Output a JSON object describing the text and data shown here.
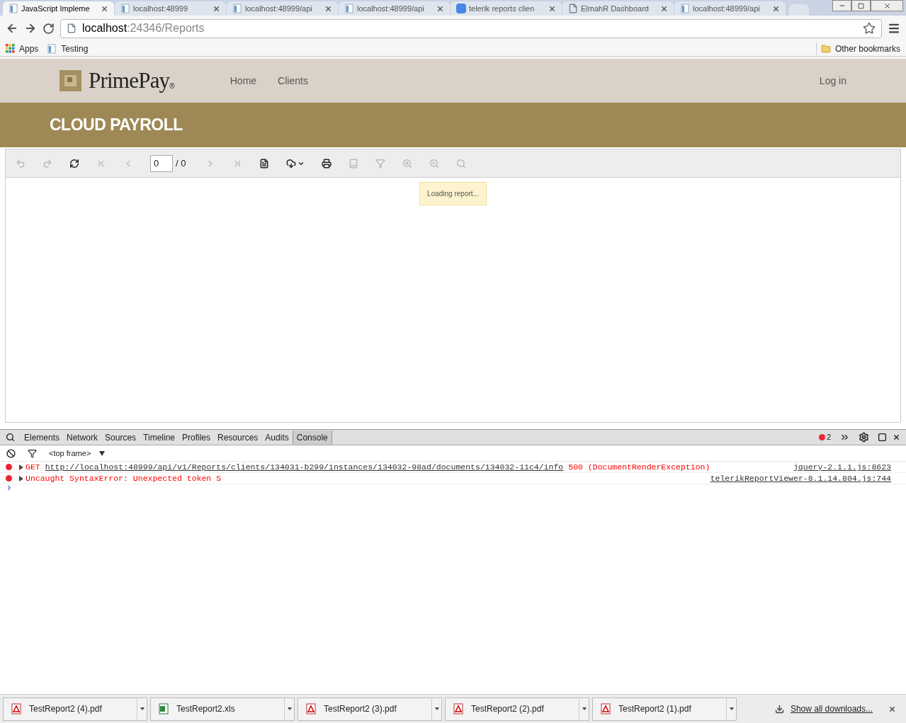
{
  "tabs": [
    {
      "label": "JavaScript Impleme",
      "kind": "doc",
      "selected": true
    },
    {
      "label": "localhost:48999",
      "kind": "doc",
      "selected": false
    },
    {
      "label": "localhost:48999/api",
      "kind": "doc",
      "selected": false
    },
    {
      "label": "localhost:48999/api",
      "kind": "doc",
      "selected": false
    },
    {
      "label": "telerik reports clien",
      "kind": "google",
      "selected": false
    },
    {
      "label": "ElmahR Dashboard",
      "kind": "page",
      "selected": false
    },
    {
      "label": "localhost:48999/api",
      "kind": "doc",
      "selected": false
    }
  ],
  "address": {
    "host": "localhost",
    "rest": ":24346/Reports"
  },
  "bookmarks": [
    {
      "label": "Apps",
      "kind": "apps"
    },
    {
      "label": "Testing",
      "kind": "doc"
    }
  ],
  "other_bookmarks": "Other bookmarks",
  "site": {
    "logo": "PrimePay",
    "logo_mark": "®",
    "nav": [
      "Home",
      "Clients"
    ],
    "login": "Log in",
    "banner": "CLOUD PAYROLL"
  },
  "viewer": {
    "buttons": [
      {
        "enabled": false
      },
      {
        "enabled": false
      },
      {
        "enabled": true
      },
      {
        "enabled": false
      },
      {
        "enabled": false
      },
      {
        "enabled": false
      },
      {
        "enabled": false
      },
      {
        "enabled": true
      },
      {
        "enabled": true
      },
      {
        "enabled": true
      },
      {
        "enabled": false
      },
      {
        "enabled": false
      },
      {
        "enabled": false
      },
      {
        "enabled": false
      },
      {
        "enabled": false
      }
    ],
    "page": "0",
    "total": "/ 0",
    "status": "Loading report..."
  },
  "devtools": {
    "tabs": [
      {
        "label": "Elements",
        "selected": false
      },
      {
        "label": "Network",
        "selected": false
      },
      {
        "label": "Sources",
        "selected": false
      },
      {
        "label": "Timeline",
        "selected": false
      },
      {
        "label": "Profiles",
        "selected": false
      },
      {
        "label": "Resources",
        "selected": false
      },
      {
        "label": "Audits",
        "selected": false
      },
      {
        "label": "Console",
        "selected": true
      }
    ],
    "error_count": "2",
    "frame": "<top frame>",
    "messages": [
      {
        "method": "GET",
        "url": "http://localhost:48999/api/v1/Reports/clients/134031-b299/instances/134032-98ad/documents/134032-11c4/info",
        "text": "500 (DocumentRenderException)",
        "source": "jquery-2.1.1.js:8623"
      },
      {
        "text": "Uncaught SyntaxError: Unexpected token S",
        "source": "telerikReportViewer-8.1.14.804.js:744"
      }
    ]
  },
  "downloads": [
    {
      "name": "TestReport2 (4).pdf",
      "kind": "pdf"
    },
    {
      "name": "TestReport2.xls",
      "kind": "xls"
    },
    {
      "name": "TestReport2 (3).pdf",
      "kind": "pdf"
    },
    {
      "name": "TestReport2 (2).pdf",
      "kind": "pdf"
    },
    {
      "name": "TestReport2 (1).pdf",
      "kind": "pdf"
    }
  ],
  "show_all": "Show all downloads..."
}
